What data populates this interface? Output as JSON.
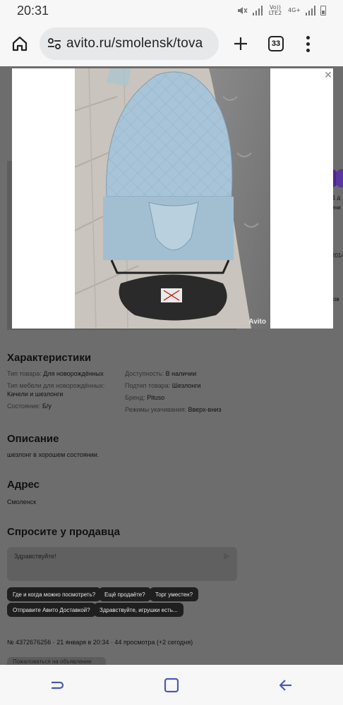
{
  "status_bar": {
    "time": "20:31",
    "network_label": "Vo)) LTE2",
    "network_label_2": "4G+"
  },
  "browser": {
    "url": "avito.ru/smolensk/tova",
    "tab_count": "33"
  },
  "listing": {
    "characteristics_title": "Характеристики",
    "characteristics_left": [
      {
        "key": "Тип товара:",
        "value": "Для новорождённых"
      },
      {
        "key": "Тип мебели для новорождённых:",
        "value": "Качели и шезлонги"
      },
      {
        "key": "Состояние:",
        "value": "Б/у"
      }
    ],
    "characteristics_right": [
      {
        "key": "Доступность:",
        "value": "В наличии"
      },
      {
        "key": "Подтип товара:",
        "value": "Шезлонги"
      },
      {
        "key": "Бренд:",
        "value": "Pituso"
      },
      {
        "key": "Режимы укачивания:",
        "value": "Вверх-вниз"
      }
    ],
    "description_title": "Описание",
    "description_text": "шезлонг в хорошем состоянии.",
    "address_title": "Адрес",
    "address_text": "Смоленск",
    "ask_title": "Спросите у продавца",
    "chat_placeholder": "Здравствуйте!",
    "quick_questions": [
      "Где и когда можно посмотреть?",
      "Ещё продаёте?",
      "Торг уместен?",
      "Отправите Авито Доставкой?",
      "Здравствуйте, игрушки есть..."
    ],
    "meta": "№ 4372676256 · 21 января в 20:34 · 44 просмотра (+2 сегодня)",
    "cut_button": "Пожаловаться на объявление",
    "side_fragments": [
      "т 1 д",
      "нени",
      "2014",
      "сов"
    ]
  },
  "overlay": {
    "watermark": "Avito",
    "close_symbol": "✕"
  }
}
